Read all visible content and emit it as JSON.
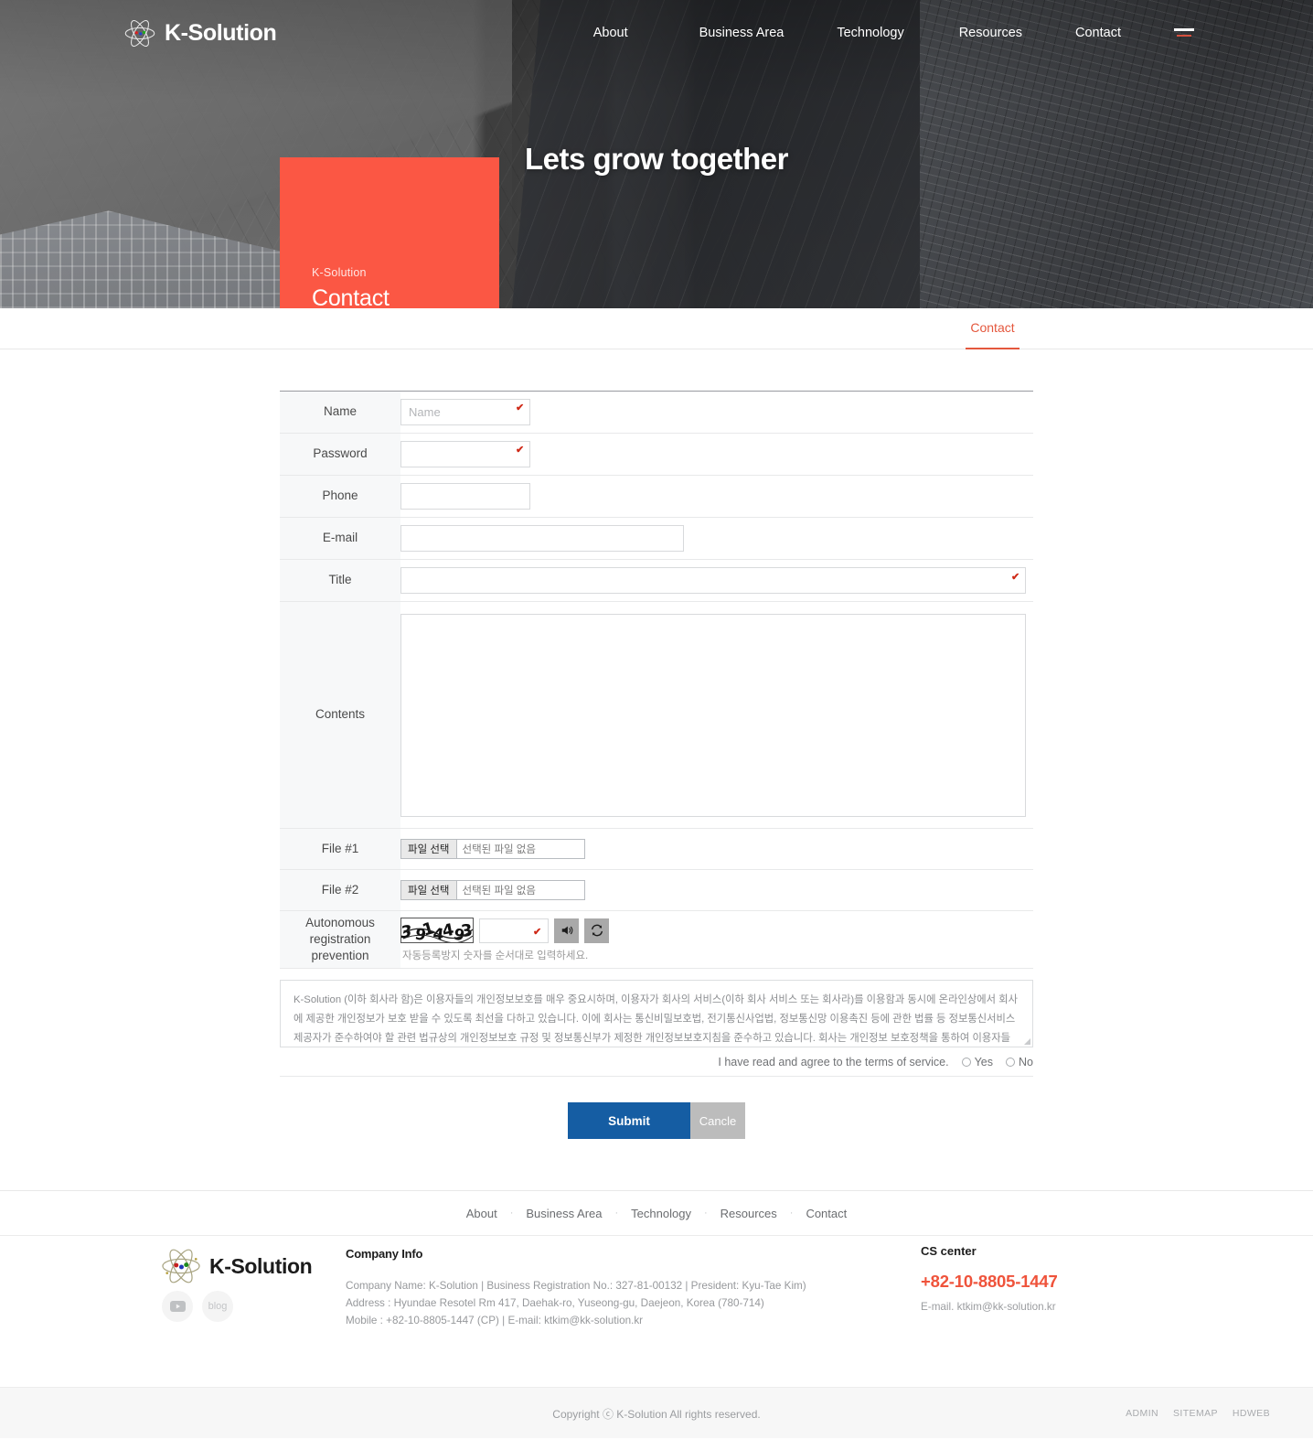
{
  "header": {
    "logo_text": "K-Solution",
    "nav": [
      {
        "label": "About"
      },
      {
        "label": "Business Area"
      },
      {
        "label": "Technology"
      },
      {
        "label": "Resources"
      },
      {
        "label": "Contact"
      }
    ],
    "menu_icon": "hamburger-icon"
  },
  "hero": {
    "headline": "Lets grow together",
    "card_sub": "K-Solution",
    "card_title": "Contact",
    "accent_color": "#fb5744"
  },
  "subtab": {
    "label": "Contact"
  },
  "form": {
    "rows": [
      {
        "label": "Name",
        "placeholder": "Name",
        "value": ""
      },
      {
        "label": "Password",
        "placeholder": "",
        "value": ""
      },
      {
        "label": "Phone",
        "placeholder": "",
        "value": ""
      },
      {
        "label": "E-mail",
        "placeholder": "",
        "value": ""
      },
      {
        "label": "Title",
        "placeholder": "",
        "value": ""
      },
      {
        "label": "Contents",
        "placeholder": "",
        "value": ""
      },
      {
        "label": "File #1"
      },
      {
        "label": "File #2"
      },
      {
        "label": "Autonomous registration prevention"
      }
    ],
    "file_button_label": "파일 선택",
    "file_status_text": "선택된 파일 없음",
    "captcha_text": "3914493",
    "captcha_hint": "자동등록방지 숫자를 순서대로 입력하세요.",
    "captcha_value": "",
    "sound_icon": "speaker-icon",
    "refresh_icon": "refresh-icon",
    "required_mark": "✔"
  },
  "terms": {
    "body": "K-Solution (이하 회사라 함)은 이용자들의 개인정보보호를 매우 중요시하며, 이용자가 회사의 서비스(이하 회사 서비스 또는 회사라)를 이용함과 동시에 온라인상에서 회사에 제공한 개인정보가 보호 받을 수 있도록 최선을 다하고 있습니다. 이에 회사는 통신비밀보호법, 전기통신사업법, 정보통신망 이용촉진 등에 관한 법률 등 정보통신서비스제공자가 준수하여야 할 관련 법규상의 개인정보보호 규정 및 정보통신부가 제정한 개인정보보호지침을 준수하고 있습니다. 회사는 개인정보 보호정책을 통하여 이용자들이 제공하는 개인정보가 어떠한 용도와 방식으로 이용되고 있으며 개인정보보호를 위해 어떠한 조치가 취해지고 있는지 알려드립니다.",
    "agree_text": "I have read and agree to the terms of service.",
    "yes_label": "Yes",
    "no_label": "No"
  },
  "buttons": {
    "submit": "Submit",
    "cancel": "Cancle"
  },
  "footer": {
    "nav": [
      {
        "label": "About"
      },
      {
        "label": "Business Area"
      },
      {
        "label": "Technology"
      },
      {
        "label": "Resources"
      },
      {
        "label": "Contact"
      }
    ],
    "separator": "·",
    "logo_text": "K-Solution",
    "social": [
      {
        "name": "youtube",
        "label": ""
      },
      {
        "name": "blog",
        "label": "blog"
      }
    ],
    "company": {
      "title": "Company Info",
      "line1": "Company Name: K-Solution  |  Business Registration No.: 327-81-00132  |  President: Kyu-Tae Kim)",
      "line2": "Address : Hyundae Resotel Rm 417, Daehak-ro, Yuseong-gu, Daejeon, Korea (780-714)",
      "line3": "Mobile : +82-10-8805-1447 (CP)  |  E-mail: ktkim@kk-solution.kr"
    },
    "cs": {
      "title": "CS center",
      "phone": "+82-10-8805-1447",
      "email": "E-mail. ktkim@kk-solution.kr",
      "phone_color": "#ef533b"
    },
    "copyright": "Copyright ⓒ K-Solution All rights reserved.",
    "bottom_links": [
      {
        "label": "ADMIN"
      },
      {
        "label": "SITEMAP"
      },
      {
        "label": "HDWEB"
      }
    ]
  }
}
